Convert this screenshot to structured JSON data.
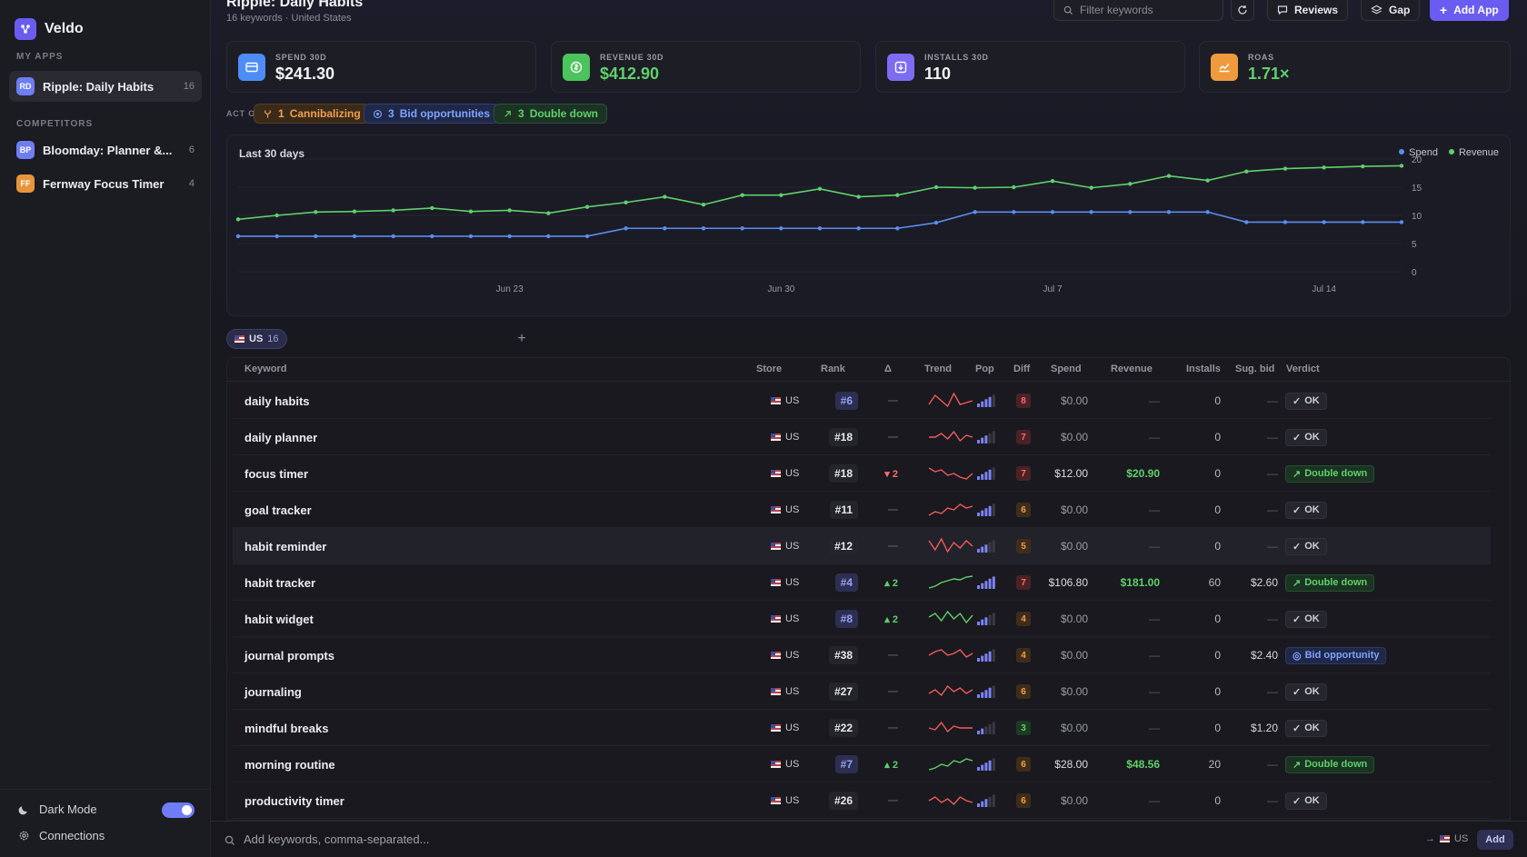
{
  "sidebar": {
    "brand": "Veldo",
    "my_apps_label": "MY APPS",
    "competitors_label": "COMPETITORS",
    "my_apps": [
      {
        "initials": "RD",
        "name": "Ripple: Daily Habits",
        "count": "16",
        "color": "#6e7df2"
      }
    ],
    "competitors": [
      {
        "initials": "BP",
        "name": "Bloomday: Planner &...",
        "count": "6",
        "color": "#6e7df2"
      },
      {
        "initials": "FF",
        "name": "Fernway Focus Timer",
        "count": "4",
        "color": "#e8943a"
      }
    ],
    "dark_mode_label": "Dark Mode",
    "connections_label": "Connections"
  },
  "header": {
    "title": "Ripple: Daily Habits",
    "subtitle": "16 keywords · United States",
    "filter_placeholder": "Filter keywords",
    "reviews_label": "Reviews",
    "gap_label": "Gap",
    "add_app_label": "Add App"
  },
  "stats": [
    {
      "label": "SPEND 30D",
      "value": "$241.30",
      "icon": "card-icon",
      "color": "#4d8df5",
      "value_color": "#f3f3f6"
    },
    {
      "label": "REVENUE 30D",
      "value": "$412.90",
      "icon": "dollar-icon",
      "color": "#4cc35c",
      "value_color": "#5fd16a"
    },
    {
      "label": "INSTALLS 30D",
      "value": "110",
      "icon": "download-icon",
      "color": "#7b6cf2",
      "value_color": "#f3f3f6"
    },
    {
      "label": "ROAS",
      "value": "1.71×",
      "icon": "trend-icon",
      "color": "#ef9a3c",
      "value_color": "#5fd16a"
    }
  ],
  "act_on": {
    "label": "ACT ON",
    "pills": [
      {
        "count": "1",
        "label": "Cannibalizing",
        "icon": "fork-icon"
      },
      {
        "count": "3",
        "label": "Bid opportunities",
        "icon": "target-icon"
      },
      {
        "count": "3",
        "label": "Double down",
        "icon": "arrow-up-right-icon"
      }
    ]
  },
  "chart_data": {
    "type": "line",
    "title": "Last 30 days",
    "x_tick_labels": [
      "Jun 23",
      "Jun 30",
      "Jul 7",
      "Jul 14"
    ],
    "ylim": [
      0,
      20
    ],
    "y_ticks": [
      0,
      5,
      10,
      15,
      20
    ],
    "legend_position": "top-right",
    "series": [
      {
        "name": "Spend",
        "color": "#5b8def",
        "values": [
          6.3,
          6.3,
          6.3,
          6.3,
          6.3,
          6.3,
          6.3,
          6.3,
          6.3,
          6.3,
          7.7,
          7.7,
          7.7,
          7.7,
          7.7,
          7.7,
          7.7,
          7.7,
          8.7,
          10.6,
          10.6,
          10.6,
          10.6,
          10.6,
          10.6,
          10.6,
          8.8,
          8.8,
          8.8,
          8.8,
          8.8
        ]
      },
      {
        "name": "Revenue",
        "color": "#5fd16a",
        "values": [
          9.3,
          10.0,
          10.6,
          10.7,
          10.9,
          11.3,
          10.7,
          10.9,
          10.4,
          11.5,
          12.3,
          13.3,
          11.9,
          13.6,
          13.6,
          14.7,
          13.3,
          13.6,
          15.0,
          14.9,
          15.0,
          16.1,
          14.9,
          15.6,
          17.0,
          16.2,
          17.8,
          18.3,
          18.5,
          18.7,
          18.8
        ]
      }
    ]
  },
  "region_chip": {
    "label": "US",
    "count": "16"
  },
  "table": {
    "columns": [
      "Keyword",
      "Store",
      "Rank",
      "Δ",
      "Trend",
      "Pop",
      "Diff",
      "Spend",
      "Revenue",
      "Installs",
      "Sug. bid",
      "Verdict"
    ],
    "rows": [
      {
        "keyword": "daily habits",
        "store": "US",
        "rank": "#6",
        "rank_top": true,
        "delta": "—",
        "delta_dir": "none",
        "pop": 4,
        "diff": "8",
        "diff_level": "high",
        "spend": "$0.00",
        "revenue": "—",
        "installs": "0",
        "bid": "—",
        "verdict": "OK",
        "verdict_type": "ok",
        "trend": [
          0.3,
          0.8,
          0.5,
          0.2,
          0.9,
          0.3,
          0.4,
          0.5
        ]
      },
      {
        "keyword": "daily planner",
        "store": "US",
        "rank": "#18",
        "rank_top": false,
        "delta": "—",
        "delta_dir": "none",
        "pop": 3,
        "diff": "7",
        "diff_level": "high",
        "spend": "$0.00",
        "revenue": "—",
        "installs": "0",
        "bid": "—",
        "verdict": "OK",
        "verdict_type": "ok",
        "trend": [
          0.5,
          0.5,
          0.7,
          0.4,
          0.8,
          0.3,
          0.6,
          0.5
        ]
      },
      {
        "keyword": "focus timer",
        "store": "US",
        "rank": "#18",
        "rank_top": false,
        "delta": "▾ 2",
        "delta_dir": "down",
        "pop": 4,
        "diff": "7",
        "diff_level": "high",
        "spend": "$12.00",
        "revenue": "$20.90",
        "installs": "0",
        "bid": "—",
        "verdict": "Double down",
        "verdict_type": "dd",
        "trend": [
          0.8,
          0.6,
          0.7,
          0.4,
          0.5,
          0.3,
          0.2,
          0.5
        ]
      },
      {
        "keyword": "goal tracker",
        "store": "US",
        "rank": "#11",
        "rank_top": false,
        "delta": "—",
        "delta_dir": "none",
        "pop": 4,
        "diff": "6",
        "diff_level": "mid",
        "spend": "$0.00",
        "revenue": "—",
        "installs": "0",
        "bid": "—",
        "verdict": "OK",
        "verdict_type": "ok",
        "trend": [
          0.2,
          0.4,
          0.3,
          0.6,
          0.5,
          0.8,
          0.6,
          0.7
        ]
      },
      {
        "keyword": "habit reminder",
        "store": "US",
        "rank": "#12",
        "rank_top": false,
        "delta": "—",
        "delta_dir": "none",
        "pop": 3,
        "diff": "5",
        "diff_level": "mid",
        "spend": "$0.00",
        "revenue": "—",
        "installs": "0",
        "bid": "—",
        "verdict": "OK",
        "verdict_type": "ok",
        "trend": [
          0.8,
          0.3,
          0.9,
          0.2,
          0.7,
          0.4,
          0.8,
          0.5
        ]
      },
      {
        "keyword": "habit tracker",
        "store": "US",
        "rank": "#4",
        "rank_top": true,
        "delta": "▴ 2",
        "delta_dir": "up",
        "pop": 5,
        "diff": "7",
        "diff_level": "high",
        "spend": "$106.80",
        "revenue": "$181.00",
        "installs": "60",
        "bid": "$2.60",
        "verdict": "Double down",
        "verdict_type": "dd",
        "trend": [
          0.2,
          0.3,
          0.5,
          0.6,
          0.7,
          0.65,
          0.8,
          0.85
        ]
      },
      {
        "keyword": "habit widget",
        "store": "US",
        "rank": "#8",
        "rank_top": true,
        "delta": "▴ 2",
        "delta_dir": "up",
        "pop": 3,
        "diff": "4",
        "diff_level": "mid",
        "spend": "$0.00",
        "revenue": "—",
        "installs": "0",
        "bid": "—",
        "verdict": "OK",
        "verdict_type": "ok",
        "trend": [
          0.6,
          0.8,
          0.4,
          0.9,
          0.5,
          0.8,
          0.3,
          0.7
        ]
      },
      {
        "keyword": "journal prompts",
        "store": "US",
        "rank": "#38",
        "rank_top": false,
        "delta": "—",
        "delta_dir": "none",
        "pop": 4,
        "diff": "4",
        "diff_level": "mid",
        "spend": "$0.00",
        "revenue": "—",
        "installs": "0",
        "bid": "$2.40",
        "verdict": "Bid opportunity",
        "verdict_type": "bid",
        "trend": [
          0.5,
          0.7,
          0.8,
          0.5,
          0.6,
          0.8,
          0.4,
          0.6
        ]
      },
      {
        "keyword": "journaling",
        "store": "US",
        "rank": "#27",
        "rank_top": false,
        "delta": "—",
        "delta_dir": "none",
        "pop": 4,
        "diff": "6",
        "diff_level": "mid",
        "spend": "$0.00",
        "revenue": "—",
        "installs": "0",
        "bid": "—",
        "verdict": "OK",
        "verdict_type": "ok",
        "trend": [
          0.4,
          0.6,
          0.3,
          0.8,
          0.5,
          0.7,
          0.4,
          0.6
        ]
      },
      {
        "keyword": "mindful breaks",
        "store": "US",
        "rank": "#22",
        "rank_top": false,
        "delta": "—",
        "delta_dir": "none",
        "pop": 2,
        "diff": "3",
        "diff_level": "low",
        "spend": "$0.00",
        "revenue": "—",
        "installs": "0",
        "bid": "$1.20",
        "verdict": "OK",
        "verdict_type": "ok",
        "trend": [
          0.5,
          0.4,
          0.8,
          0.3,
          0.6,
          0.5,
          0.5,
          0.5
        ]
      },
      {
        "keyword": "morning routine",
        "store": "US",
        "rank": "#7",
        "rank_top": true,
        "delta": "▴ 2",
        "delta_dir": "up",
        "pop": 4,
        "diff": "6",
        "diff_level": "mid",
        "spend": "$28.00",
        "revenue": "$48.56",
        "installs": "20",
        "bid": "—",
        "verdict": "Double down",
        "verdict_type": "dd",
        "trend": [
          0.2,
          0.3,
          0.5,
          0.4,
          0.7,
          0.6,
          0.8,
          0.7
        ]
      },
      {
        "keyword": "productivity timer",
        "store": "US",
        "rank": "#26",
        "rank_top": false,
        "delta": "—",
        "delta_dir": "none",
        "pop": 3,
        "diff": "6",
        "diff_level": "mid",
        "spend": "$0.00",
        "revenue": "—",
        "installs": "0",
        "bid": "—",
        "verdict": "OK",
        "verdict_type": "ok",
        "trend": [
          0.5,
          0.7,
          0.4,
          0.6,
          0.3,
          0.7,
          0.5,
          0.4
        ]
      }
    ]
  },
  "add_bar": {
    "placeholder": "Add keywords, comma-separated...",
    "region": "US",
    "add_label": "Add"
  }
}
